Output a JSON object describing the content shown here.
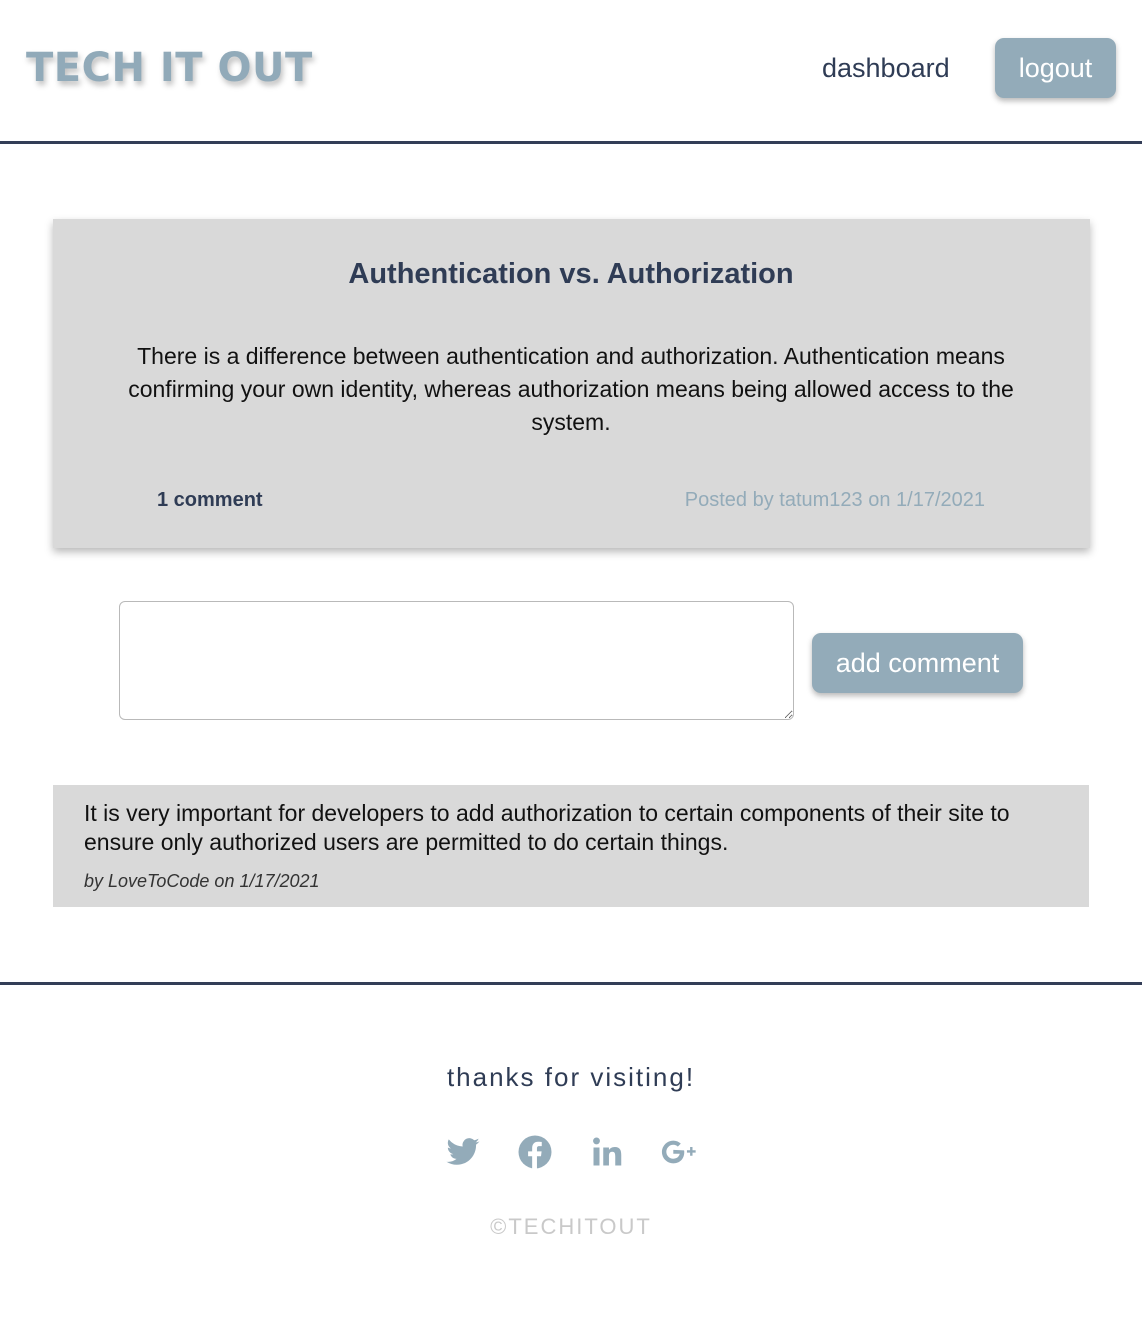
{
  "header": {
    "logo": "TECH IT OUT",
    "nav_dashboard": "dashboard",
    "logout_label": "logout"
  },
  "post": {
    "title": "Authentication vs. Authorization",
    "body": "There is a difference between authentication and authorization. Authentication means confirming your own identity, whereas authorization means being allowed access to the system.",
    "comment_count": "1 comment",
    "meta": "Posted by tatum123 on 1/17/2021"
  },
  "comment_form": {
    "placeholder": "",
    "submit_label": "add comment"
  },
  "comments": [
    {
      "text": "It is very important for developers to add authorization to certain components of their site to ensure only authorized users are permitted to do certain things.",
      "meta": "by LoveToCode on 1/17/2021"
    }
  ],
  "footer": {
    "thanks": "thanks for visiting!",
    "social_icons": [
      "twitter-icon",
      "facebook-icon",
      "linkedin-icon",
      "google-plus-icon"
    ],
    "copyright": "©TECHITOUT"
  },
  "colors": {
    "accent": "#93abb9",
    "navy": "#2f3c55",
    "card": "#d9d9d9"
  }
}
